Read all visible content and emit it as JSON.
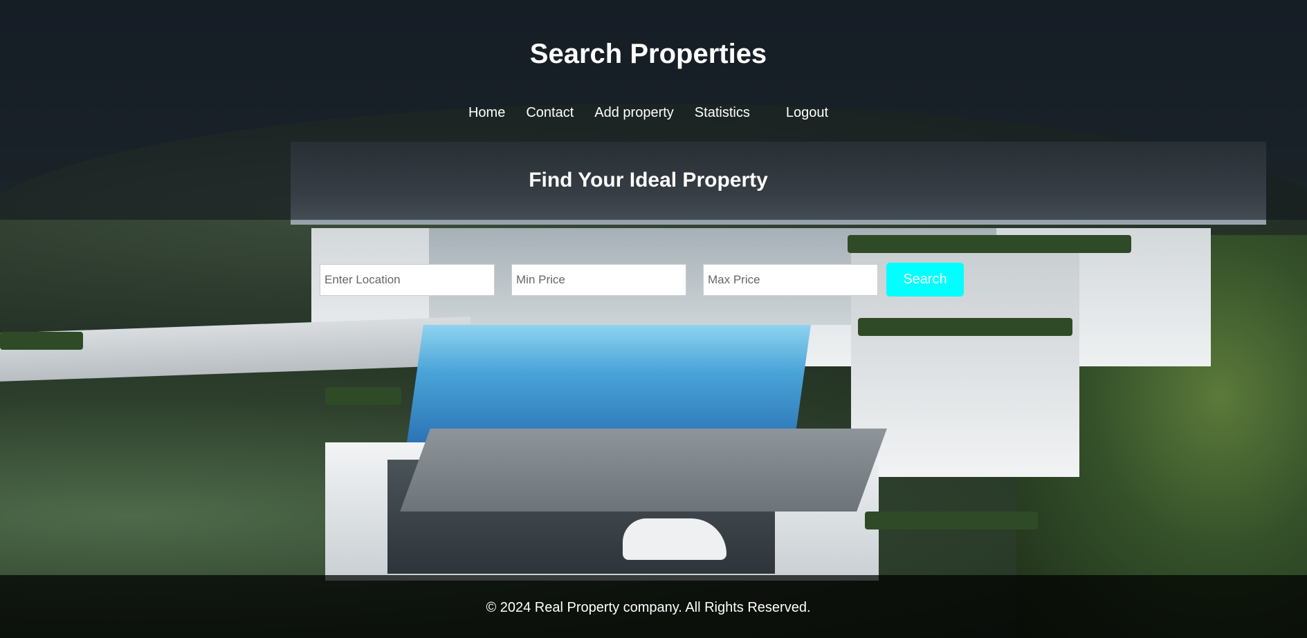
{
  "header": {
    "title": "Search Properties"
  },
  "nav": {
    "items": [
      {
        "label": "Home"
      },
      {
        "label": "Contact"
      },
      {
        "label": "Add property"
      },
      {
        "label": "Statistics"
      },
      {
        "label": "Logout"
      }
    ]
  },
  "search": {
    "heading": "Find Your Ideal Property",
    "location_placeholder": "Enter Location",
    "min_price_placeholder": "Min Price",
    "max_price_placeholder": "Max Price",
    "button_label": "Search",
    "button_color": "#00ffff"
  },
  "footer": {
    "text": "© 2024 Real Property company. All Rights Reserved."
  }
}
